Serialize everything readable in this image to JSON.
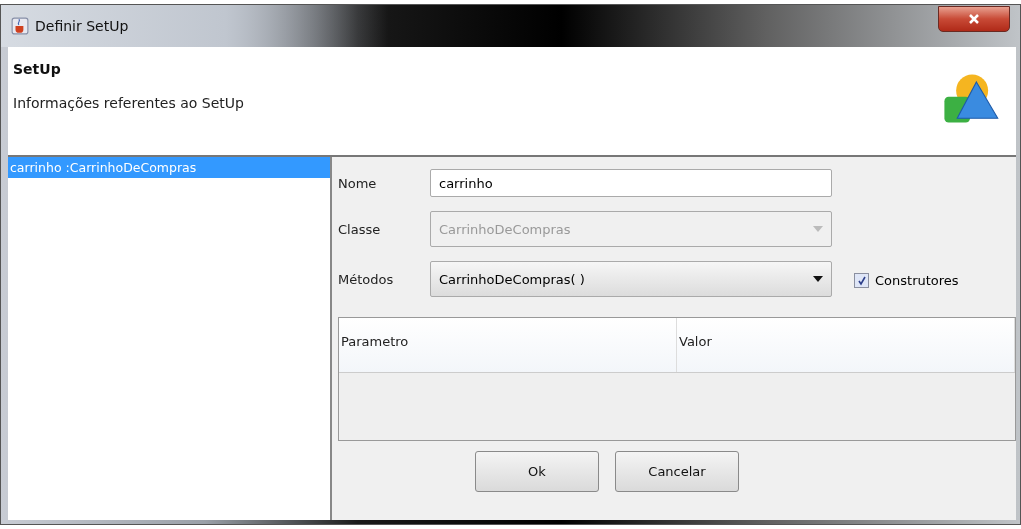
{
  "window": {
    "title": "Definir SetUp"
  },
  "header": {
    "title": "SetUp",
    "description": "Informações referentes ao SetUp"
  },
  "list": [
    {
      "label": "carrinho :CarrinhoDeCompras",
      "selected": true
    }
  ],
  "form": [
    {
      "kind": "text",
      "label": "Nome",
      "value": "carrinho",
      "disabled": false
    },
    {
      "kind": "combo",
      "label": "Classe",
      "value": "CarrinhoDeCompras",
      "disabled": true
    },
    {
      "kind": "combo",
      "label": "Métodos",
      "value": "CarrinhoDeCompras( )",
      "disabled": false
    }
  ],
  "checkbox": {
    "label": "Construtores",
    "checked": true
  },
  "table": {
    "columns": [
      "Parametro",
      "Valor"
    ]
  },
  "buttons": [
    "Ok",
    "Cancelar"
  ]
}
